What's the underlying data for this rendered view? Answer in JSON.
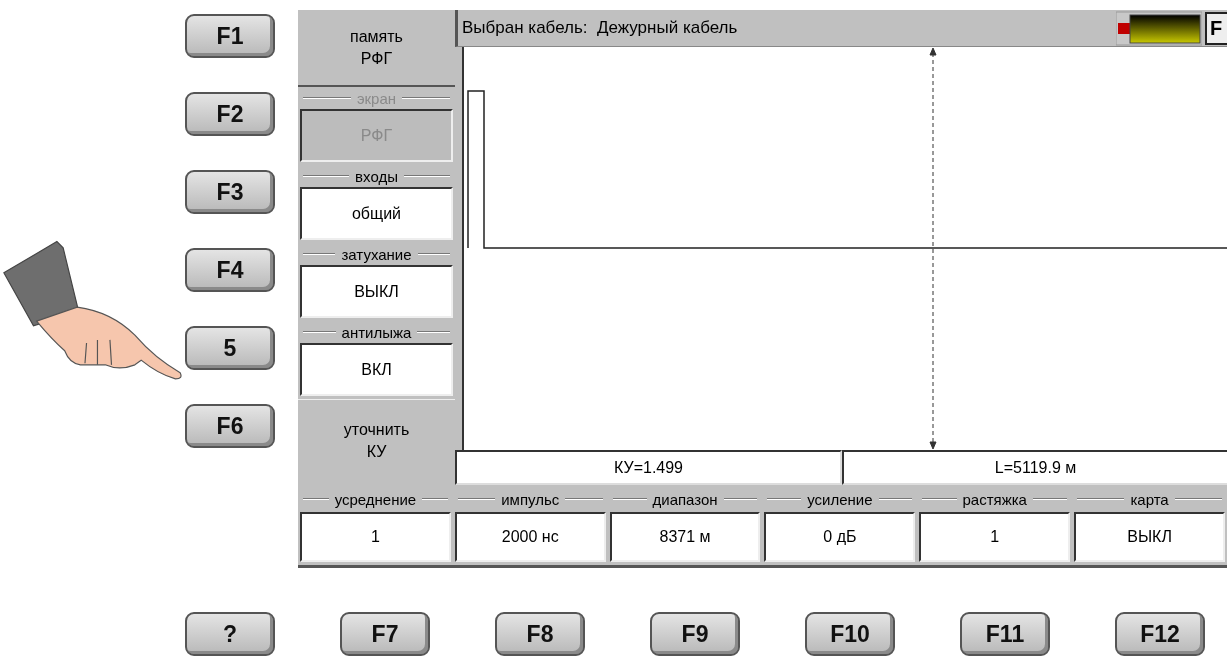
{
  "side_keys": [
    "F1",
    "F2",
    "F3",
    "F4",
    "5",
    "F6"
  ],
  "menu": [
    {
      "kind": "button",
      "lines": [
        "память",
        "РФГ"
      ]
    },
    {
      "kind": "field",
      "caption": "экран",
      "value": "РФГ",
      "disabled": true
    },
    {
      "kind": "field",
      "caption": "входы",
      "value": "общий",
      "disabled": false
    },
    {
      "kind": "field",
      "caption": "затухание",
      "value": "ВЫКЛ",
      "disabled": false
    },
    {
      "kind": "field",
      "caption": "антилыжа",
      "value": "ВКЛ",
      "disabled": false
    },
    {
      "kind": "button",
      "lines": [
        "уточнить",
        "КУ"
      ]
    }
  ],
  "cable_bar": {
    "text": "Выбран кабель:  Дежурный кабель",
    "corner_key": "F"
  },
  "readouts": [
    "КУ=1.499",
    "L=5119.9 м"
  ],
  "params": [
    {
      "caption": "усреднение",
      "value": "1"
    },
    {
      "caption": "импульс",
      "value": "2000 нс"
    },
    {
      "caption": "диапазон",
      "value": "8371 м"
    },
    {
      "caption": "усиление",
      "value": "0 дБ"
    },
    {
      "caption": "растяжка",
      "value": "1"
    },
    {
      "caption": "карта",
      "value": "ВЫКЛ"
    }
  ],
  "bottom_keys": [
    "?",
    "F7",
    "F8",
    "F9",
    "F10",
    "F11",
    "F12"
  ]
}
